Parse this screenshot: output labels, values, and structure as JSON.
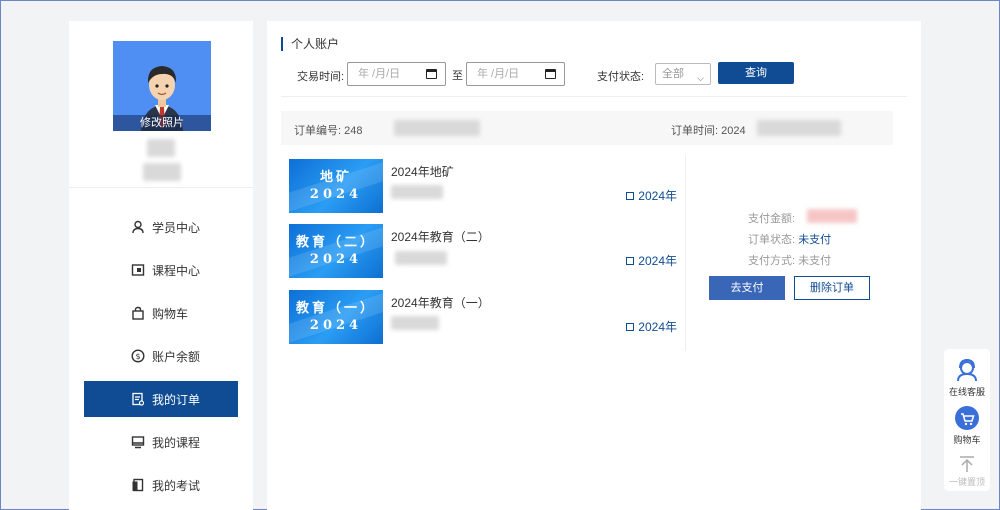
{
  "sidebar": {
    "avatar_label": "修改照片",
    "nav": [
      {
        "label": "学员中心",
        "icon": "user-icon"
      },
      {
        "label": "课程中心",
        "icon": "course-icon"
      },
      {
        "label": "购物车",
        "icon": "bag-icon"
      },
      {
        "label": "账户余额",
        "icon": "dollar-icon"
      },
      {
        "label": "我的订单",
        "icon": "order-icon",
        "active": true
      },
      {
        "label": "我的课程",
        "icon": "monitor-icon"
      },
      {
        "label": "我的考试",
        "icon": "exam-icon"
      }
    ]
  },
  "main": {
    "title": "个人账户",
    "filter": {
      "time_label": "交易时间:",
      "date_placeholder": "年 /月/日",
      "to_label": "至",
      "status_label": "支付状态:",
      "status_value": "全部",
      "query_button": "查询"
    },
    "order": {
      "no_label": "订单编号: 248",
      "time_label": "订单时间: 2024",
      "courses": [
        {
          "thumb_line1": "地矿",
          "thumb_line2": "2024",
          "name": "2024年地矿",
          "year": "2024年"
        },
        {
          "thumb_line1": "教育（二）",
          "thumb_line2": "2024",
          "name": "2024年教育（二）",
          "year": "2024年"
        },
        {
          "thumb_line1": "教育（一）",
          "thumb_line2": "2024",
          "name": "2024年教育（一）",
          "year": "2024年"
        }
      ],
      "pay_amount_label": "支付金额:",
      "status_label": "订单状态:",
      "status_value": "未支付",
      "method_label": "支付方式:",
      "method_value": "未支付",
      "pay_button": "去支付",
      "delete_button": "删除订单"
    }
  },
  "float": {
    "consult": "在线客服",
    "cart": "购物车",
    "top": "一键置顶"
  },
  "colors": {
    "primary": "#0f4c93",
    "avatar_bg": "#4f8ef2",
    "thumb": "#1a86e8"
  }
}
